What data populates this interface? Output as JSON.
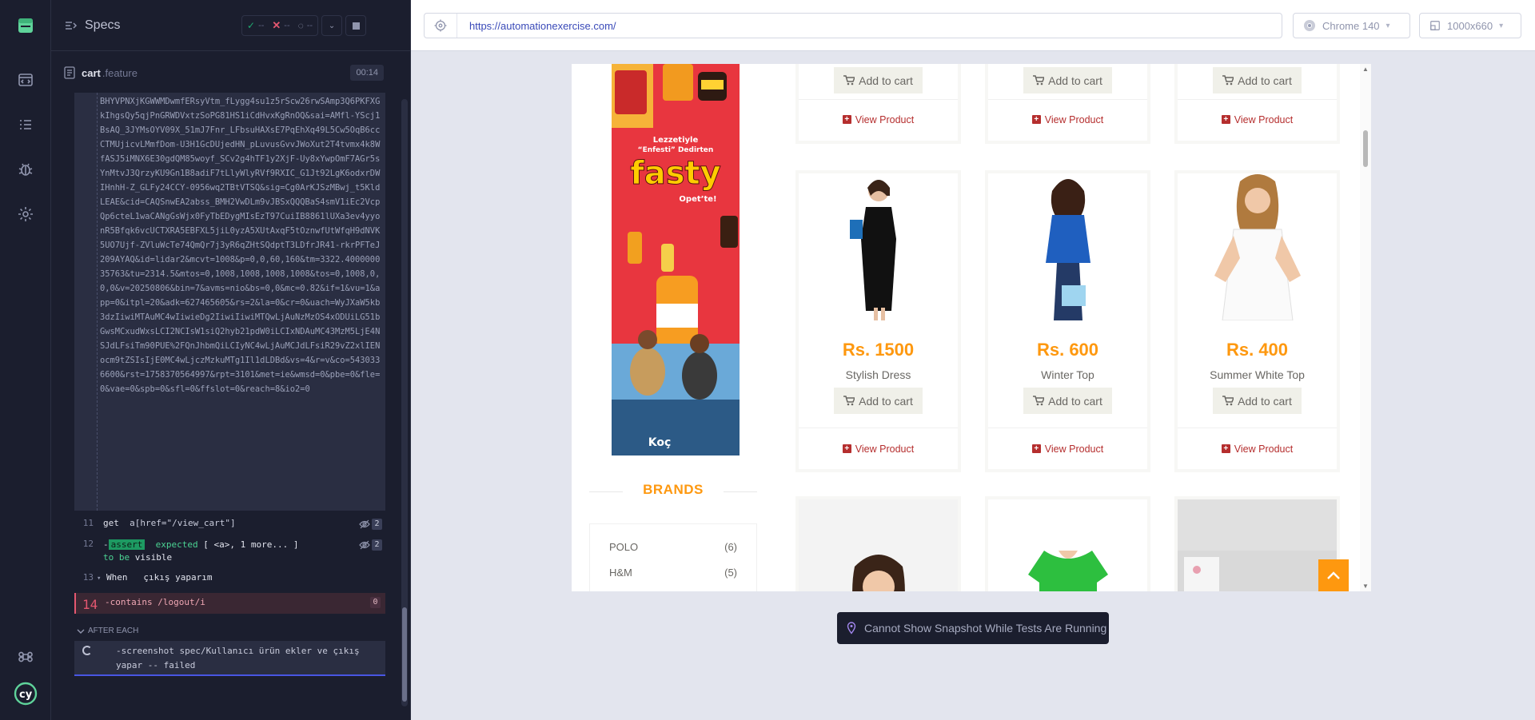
{
  "reporter": {
    "specs_title": "Specs",
    "stats": {
      "passed": "--",
      "failed": "--",
      "pending": "--"
    },
    "spec_name": "cart",
    "spec_ext": ".feature",
    "duration": "00:14"
  },
  "log": {
    "url_text": "BHYVPNXjKGWWMDwmfERsyVtm_fLygg4su1z5rScw26rwSAmp3Q6PKFXGkIhgsQy5qjPnGRWDVxtzSoPG81HS1iCdHvxKgRnOQ&sai=AMfl-YScj1BsAQ_3JYMsOYV09X_51mJ7Fnr_LFbsuHAXsE7PqEhXq49L5Cw5OqB6ccCTMUjicvLMmfDom-U3H1GcDUjedHN_pLuvusGvvJWoXut2T4tvmx4k8WfASJ5iMNX6E30gdQM85woyf_SCv2g4hTF1y2XjF-Uy8xYwpOmF7AGr5sYnMtvJ3QrzyKU9Gn1B8adiF7tLlyWlyRVf9RXIC_G1Jt92LgK6odxrDWIHnhH-Z_GLFy24CCY-0956wq2TBtVTSQ&sig=Cg0ArKJSzMBwj_t5KldLEAE&cid=CAQSnwEA2abss_BMH2VwDLm9vJBSxQQQBaS4smV1iEc2VcpQp6cteL1waCANgGsWjx0FyTbEDygMIsEzT97CuiIB8861lUXa3ev4yyonR5Bfqk6vcUCTXRA5EBFXL5jiL0yzA5XUtAxqF5tOznwfUtWfqH9dNVK5UO7Ujf-ZVluWcTe74QmQr7j3yR6qZHtSQdptT3LDfrJR41-rkrPFTeJ209AYAQ&id=lidar2&mcvt=1008&p=0,0,60,160&tm=3322.400000035763&tu=2314.5&mtos=0,1008,1008,1008,1008&tos=0,1008,0,0,0&v=20250806&bin=7&avms=nio&bs=0,0&mc=0.82&if=1&vu=1&app=0&itpl=20&adk=627465605&rs=2&la=0&cr=0&uach=WyJXaW5kb3dzIiwiMTAuMC4wIiwieDg2IiwiIiwiMTQwLjAuNzMzOS4xODUiLG51bGwsMCxudWxsLCI2NCIsW1siQ2hyb21pdW0iLCIxNDAuMC43MzM5LjE4NSJdLFsiTm90PUE%2FQnJhbmQiLCIyNC4wLjAuMCJdLFsiR29vZ2xlIENocm9tZSIsIjE0MC4wLjczMzkuMTg1Il1dLDBd&vs=4&r=v&co=5430336600&rst=1758370564997&rpt=3101&met=ie&wmsd=0&pbe=0&fle=0&vae=0&spb=0&sfl=0&ffslot=0&reach=8&io2=0",
    "cmd11": {
      "num": "11",
      "name": "get",
      "arg": "a[href=\"/view_cart\"]",
      "count": "2"
    },
    "cmd12": {
      "num": "12",
      "prefix": "-",
      "name": "assert",
      "word1": "expected",
      "subject": "[ <a>, 1 more... ]",
      "word2": "to be",
      "word3": "visible",
      "count": "2"
    },
    "cmd13": {
      "num": "13",
      "keyword": "When",
      "text": "çıkış yaparım"
    },
    "cmd14": {
      "num": "14",
      "text": "-contains  /logout/i",
      "count": "0"
    },
    "after_each": "AFTER EACH",
    "after_each_cmd": "-screenshot  spec/Kullanıcı ürün ekler ve çıkış yapar -- failed"
  },
  "browser": {
    "url": "https://automationexercise.com/",
    "browser_name": "Chrome 140",
    "viewport": "1000x660"
  },
  "site": {
    "add_to_cart": "Add to cart",
    "view_product": "View Product",
    "ad_text": {
      "line1": "Lezzetiyle",
      "line2": "“Enfesti” Dedirten",
      "brand": "fasty",
      "tagline": "Opet’te!",
      "sponsor": "Koç"
    },
    "products": [
      {
        "price": "Rs. 1500",
        "name": "Stylish Dress"
      },
      {
        "price": "Rs. 600",
        "name": "Winter Top"
      },
      {
        "price": "Rs. 400",
        "name": "Summer White Top"
      }
    ],
    "brands_title": "BRANDS",
    "brands": [
      {
        "name": "POLO",
        "count": "(6)"
      },
      {
        "name": "H&M",
        "count": "(5)"
      }
    ]
  },
  "snapshot_message": "Cannot Show Snapshot While Tests Are Running",
  "colors": {
    "accent": "#fe980f",
    "fail": "#e45770",
    "pass": "#1fa971",
    "link": "#b52e2e"
  }
}
